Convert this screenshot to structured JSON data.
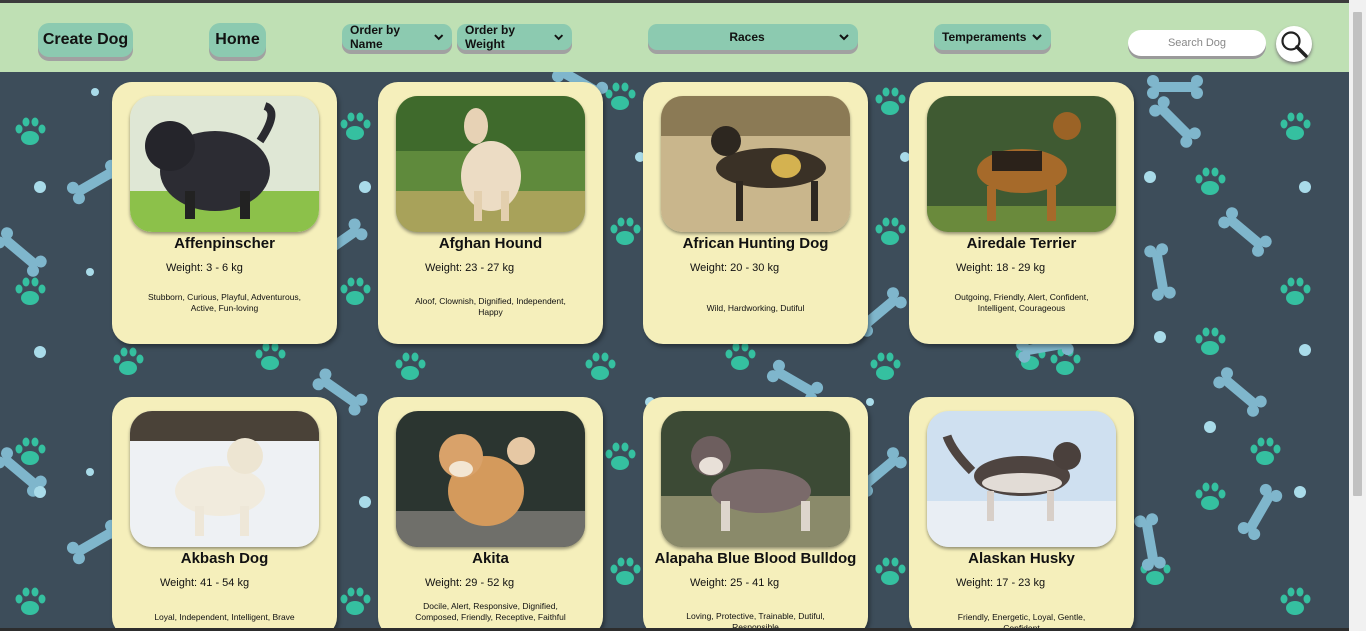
{
  "header": {
    "create_label": "Create Dog",
    "home_label": "Home",
    "order_name_label": "Order by Name",
    "order_weight_label": "Order by Weight",
    "races_label": "Races",
    "temperaments_label": "Temperaments",
    "search_placeholder": "Search Dog"
  },
  "colors": {
    "header_bg": "#bfe0b4",
    "button_bg": "#8ccab0",
    "card_bg": "#f5efbb",
    "pattern_bg": "#3d4d5a",
    "paw_color": "#35c0a0",
    "bone_color": "#7fb6cc"
  },
  "cards": [
    {
      "name": "Affenpinscher",
      "weight": "Weight: 3 - 6 kg",
      "temperament": "Stubborn, Curious, Playful, Adventurous, Active, Fun-loving"
    },
    {
      "name": "Afghan Hound",
      "weight": "Weight: 23 - 27 kg",
      "temperament": "Aloof, Clownish, Dignified, Independent, Happy"
    },
    {
      "name": "African Hunting Dog",
      "weight": "Weight: 20 - 30 kg",
      "temperament": "Wild, Hardworking, Dutiful"
    },
    {
      "name": "Airedale Terrier",
      "weight": "Weight: 18 - 29 kg",
      "temperament": "Outgoing, Friendly, Alert, Confident, Intelligent, Courageous"
    },
    {
      "name": "Akbash Dog",
      "weight": "Weight: 41 - 54 kg",
      "temperament": "Loyal, Independent, Intelligent, Brave"
    },
    {
      "name": "Akita",
      "weight": "Weight: 29 - 52 kg",
      "temperament": "Docile, Alert, Responsive, Dignified, Composed, Friendly, Receptive, Faithful"
    },
    {
      "name": "Alapaha Blue Blood Bulldog",
      "weight": "Weight: 25 - 41 kg",
      "temperament": "Loving, Protective, Trainable, Dutiful, Responsible"
    },
    {
      "name": "Alaskan Husky",
      "weight": "Weight: 17 - 23 kg",
      "temperament": "Friendly, Energetic, Loyal, Gentle, Confident"
    }
  ]
}
